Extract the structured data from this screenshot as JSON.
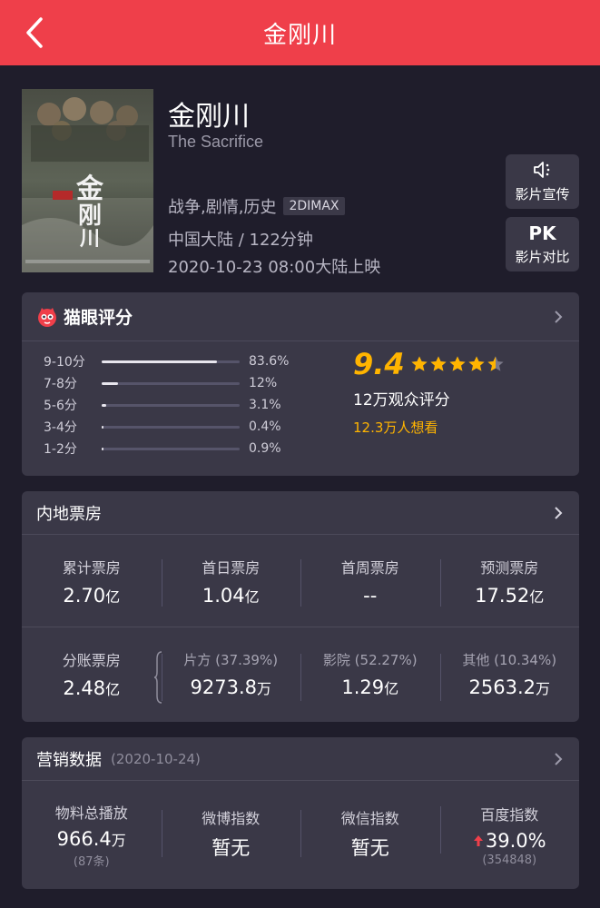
{
  "header": {
    "title": "金刚川",
    "back_icon": "back-arrow-icon"
  },
  "movie": {
    "title": "金刚川",
    "english_title": "The Sacrifice",
    "genres": "战争,剧情,历史",
    "format": "2DIMAX",
    "region_duration": "中国大陆 / 122分钟",
    "release": "2020-10-23 08:00大陆上映"
  },
  "actions": {
    "promo": {
      "icon": "speaker-icon",
      "label": "影片宣传"
    },
    "pk": {
      "icon_text": "PK",
      "label": "影片对比"
    }
  },
  "rating": {
    "brand": "猫眼评分",
    "score": "9.4",
    "stars": 4.5,
    "audience": "12万观众评分",
    "want": "12.3万人想看",
    "distribution": [
      {
        "label": "9-10分",
        "pct": "83.6%",
        "value": 83.6
      },
      {
        "label": "7-8分",
        "pct": "12%",
        "value": 12
      },
      {
        "label": "5-6分",
        "pct": "3.1%",
        "value": 3.1
      },
      {
        "label": "3-4分",
        "pct": "0.4%",
        "value": 0.4
      },
      {
        "label": "1-2分",
        "pct": "0.9%",
        "value": 0.9
      }
    ]
  },
  "boxoffice": {
    "title": "内地票房",
    "stats": [
      {
        "label": "累计票房",
        "value": "2.70",
        "unit": "亿"
      },
      {
        "label": "首日票房",
        "value": "1.04",
        "unit": "亿"
      },
      {
        "label": "首周票房",
        "value": "--",
        "unit": ""
      },
      {
        "label": "预测票房",
        "value": "17.52",
        "unit": "亿"
      }
    ],
    "split": [
      {
        "label": "分账票房",
        "value": "2.48",
        "unit": "亿"
      },
      {
        "label": "片方 (37.39%)",
        "value": "9273.8",
        "unit": "万"
      },
      {
        "label": "影院 (52.27%)",
        "value": "1.29",
        "unit": "亿"
      },
      {
        "label": "其他 (10.34%)",
        "value": "2563.2",
        "unit": "万"
      }
    ]
  },
  "marketing": {
    "title": "营销数据",
    "date": "(2020-10-24)",
    "stats": [
      {
        "label": "物料总播放",
        "value": "966.4",
        "unit": "万",
        "sub": "(87条)"
      },
      {
        "label": "微博指数",
        "value": "暂无",
        "unit": "",
        "sub": ""
      },
      {
        "label": "微信指数",
        "value": "暂无",
        "unit": "",
        "sub": ""
      },
      {
        "label": "百度指数",
        "value": "39.0%",
        "unit": "",
        "sub": "(354848)"
      }
    ]
  },
  "colors": {
    "header_bg": "#ef3f4a",
    "accent": "#ffb400",
    "up": "#ef3f4a"
  }
}
